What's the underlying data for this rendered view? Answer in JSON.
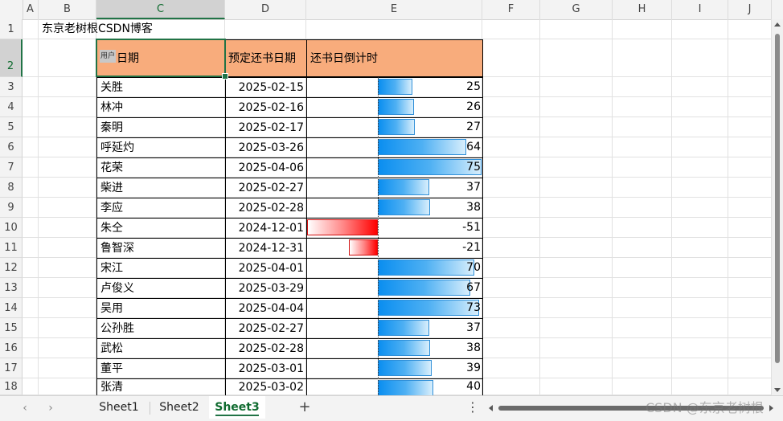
{
  "columns": [
    "A",
    "B",
    "C",
    "D",
    "E",
    "F",
    "G",
    "H",
    "I",
    "J"
  ],
  "selected_column": "C",
  "rows": [
    "1",
    "2",
    "3",
    "4",
    "5",
    "6",
    "7",
    "8",
    "9",
    "10",
    "11",
    "12",
    "13",
    "14",
    "15",
    "16",
    "17",
    "18"
  ],
  "selected_row": "2",
  "title_cell": "东京老树根CSDN博客",
  "table_header": {
    "name": "日期",
    "name_overlay": "用户",
    "due": "预定还书日期",
    "countdown": "还书日倒计时"
  },
  "records": [
    {
      "name": "关胜",
      "date": "2025-02-15",
      "days": 25
    },
    {
      "name": "林冲",
      "date": "2025-02-16",
      "days": 26
    },
    {
      "name": "秦明",
      "date": "2025-02-17",
      "days": 27
    },
    {
      "name": "呼延灼",
      "date": "2025-03-26",
      "days": 64
    },
    {
      "name": "花荣",
      "date": "2025-04-06",
      "days": 75
    },
    {
      "name": "柴进",
      "date": "2025-02-27",
      "days": 37
    },
    {
      "name": "李应",
      "date": "2025-02-28",
      "days": 38
    },
    {
      "name": "朱仝",
      "date": "2024-12-01",
      "days": -51
    },
    {
      "name": "鲁智深",
      "date": "2024-12-31",
      "days": -21
    },
    {
      "name": "宋江",
      "date": "2025-04-01",
      "days": 70
    },
    {
      "name": "卢俊义",
      "date": "2025-03-29",
      "days": 67
    },
    {
      "name": "吴用",
      "date": "2025-04-04",
      "days": 73
    },
    {
      "name": "公孙胜",
      "date": "2025-02-27",
      "days": 37
    },
    {
      "name": "武松",
      "date": "2025-02-28",
      "days": 38
    },
    {
      "name": "董平",
      "date": "2025-03-01",
      "days": 39
    },
    {
      "name": "张清",
      "date": "2025-03-02",
      "days": 40
    }
  ],
  "data_bar": {
    "max": 75,
    "positive_color": "#0a8ef0",
    "negative_color": "#ff0000"
  },
  "sheets": [
    {
      "label": "Sheet1",
      "active": false
    },
    {
      "label": "Sheet2",
      "active": false
    },
    {
      "label": "Sheet3",
      "active": true
    }
  ],
  "add_sheet_label": "+",
  "more_label": "⋮",
  "nav": {
    "prev": "‹",
    "next": "›"
  },
  "watermark": "CSDN @东京老树根",
  "colors": {
    "accent": "#217346",
    "header_fill": "#f8ac7c"
  }
}
